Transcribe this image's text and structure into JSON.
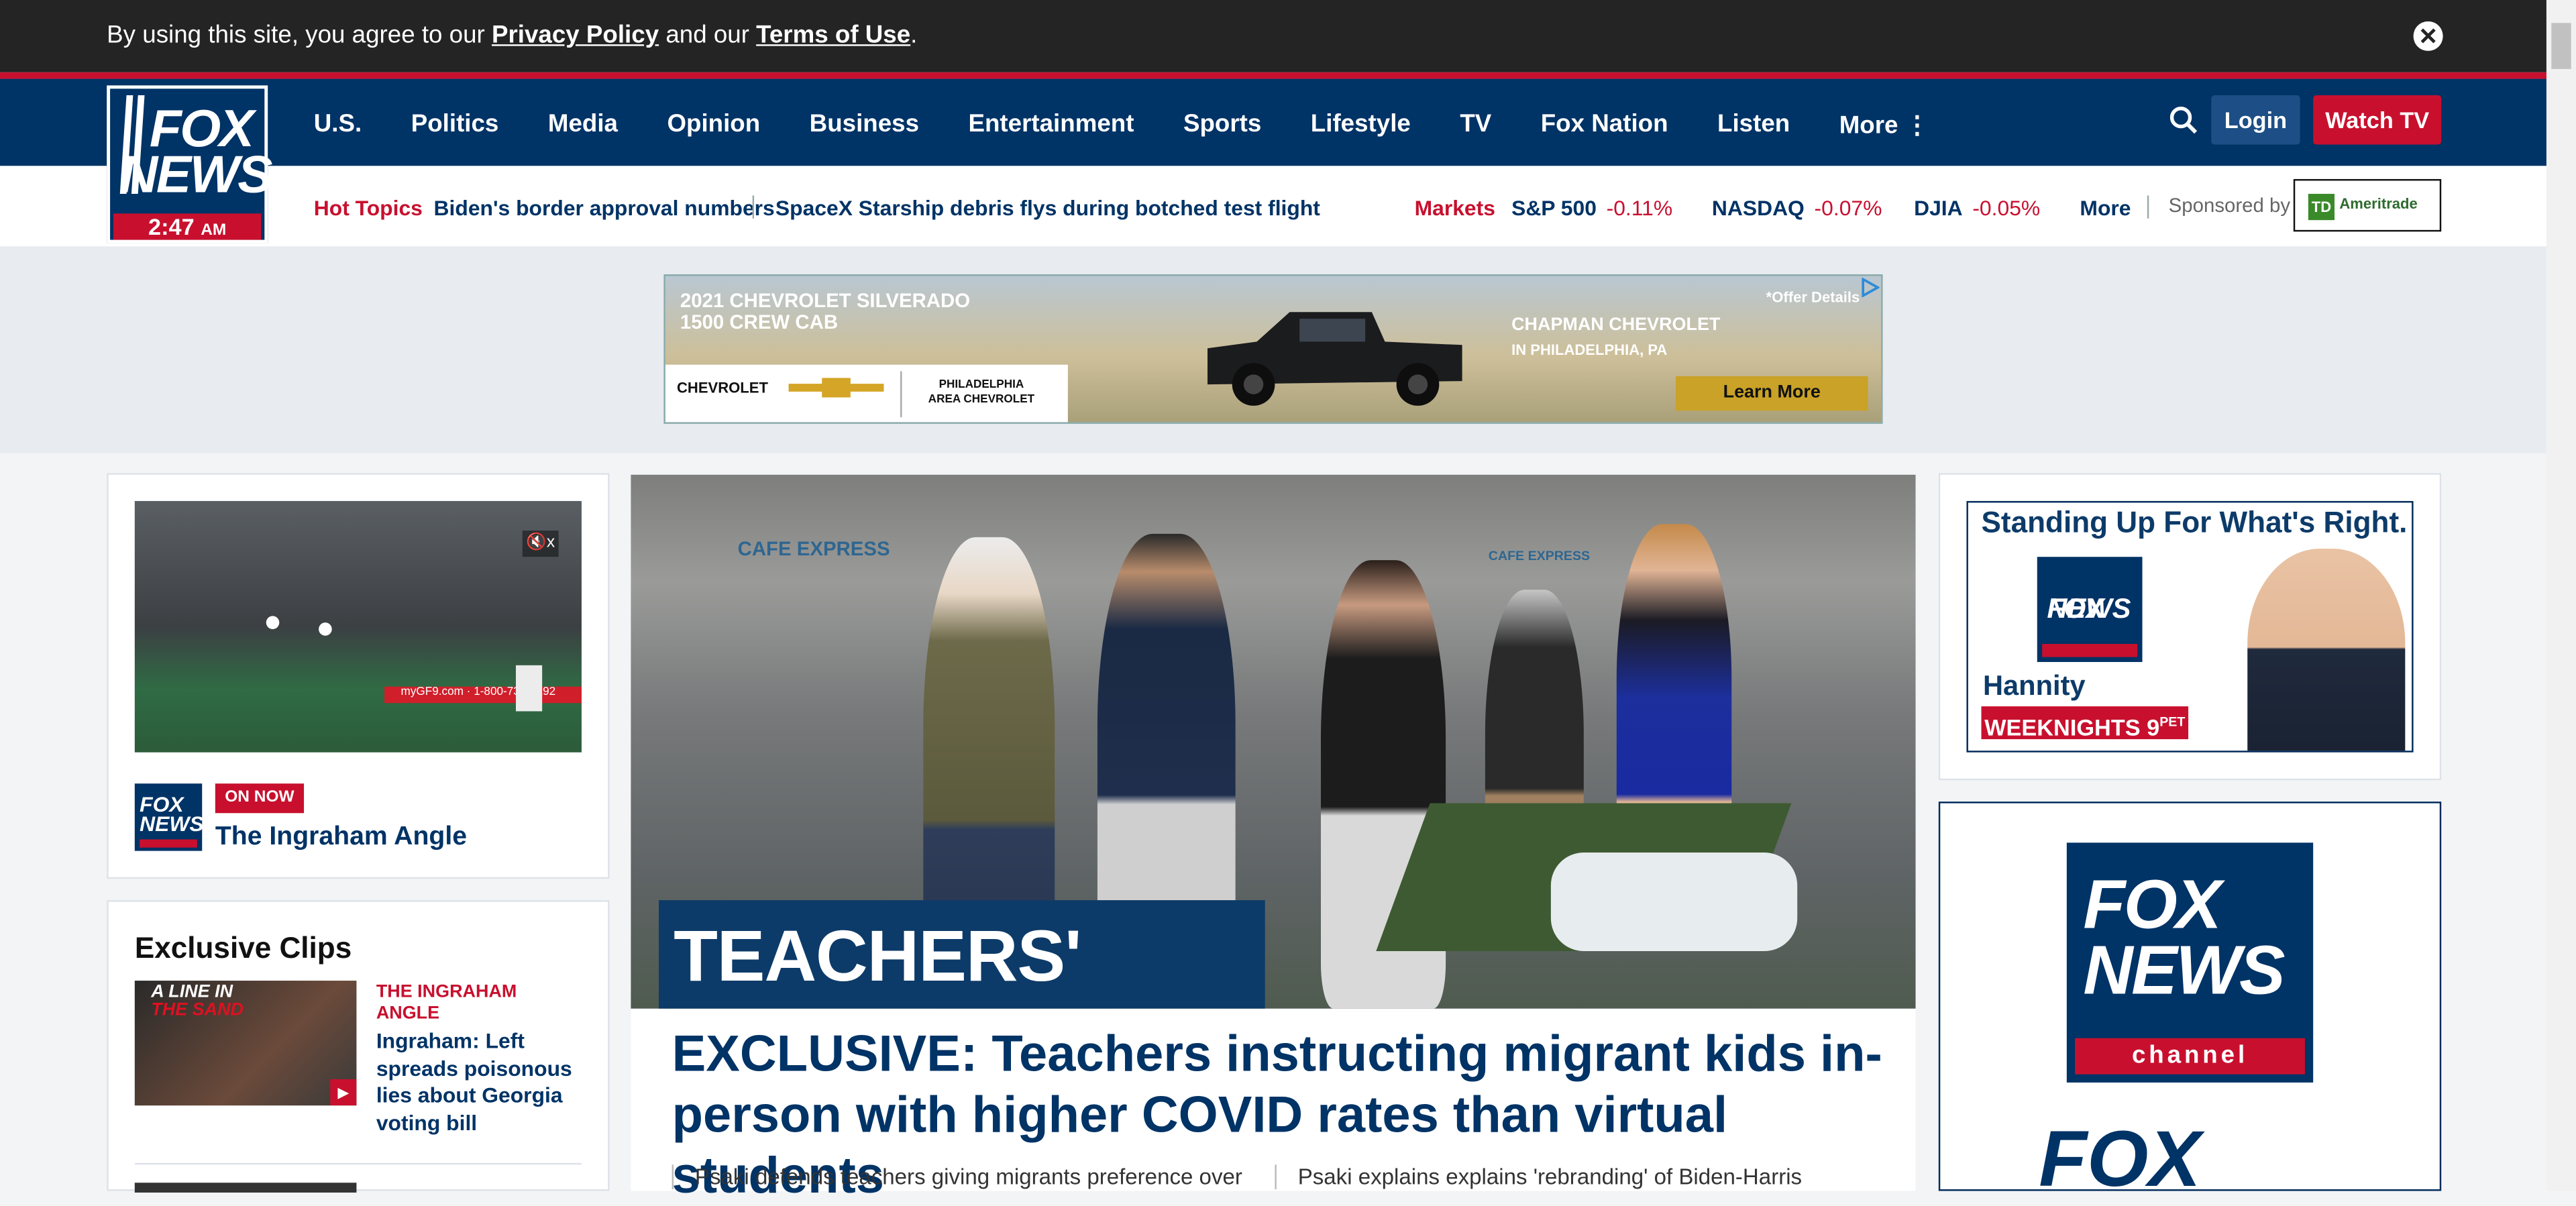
{
  "cookie": {
    "text_pre": "By using this site, you agree to our ",
    "privacy": "Privacy Policy",
    "text_mid": " and our ",
    "terms": "Terms of Use",
    "text_post": "."
  },
  "logo": {
    "word1": "FOX",
    "word2": "NEWS",
    "time": "2:47",
    "ampm": "AM"
  },
  "nav": {
    "items": [
      "U.S.",
      "Politics",
      "Media",
      "Opinion",
      "Business",
      "Entertainment",
      "Sports",
      "Lifestyle",
      "TV",
      "Fox Nation",
      "Listen",
      "More ⋮"
    ],
    "login": "Login",
    "watch": "Watch TV"
  },
  "hot": {
    "label": "Hot Topics",
    "topic1": "Biden's border approval numbers",
    "topic2": "SpaceX Starship debris flys during botched test flight",
    "markets": "Markets",
    "stocks": [
      {
        "name": "S&P 500",
        "change": "-0.11%"
      },
      {
        "name": "NASDAQ",
        "change": "-0.07%"
      },
      {
        "name": "DJIA",
        "change": "-0.05%"
      }
    ],
    "more": "More",
    "sponsored": "Sponsored by",
    "sponsor_name": "Ameritrade",
    "sponsor_box": "TD"
  },
  "ad": {
    "headline1": "2021 CHEVROLET SILVERADO",
    "headline2": "1500 CREW CAB",
    "dealer1": "CHAPMAN CHEVROLET",
    "dealer2": "IN PHILADELPHIA, PA",
    "offer": "*Offer Details",
    "cta": "Learn More",
    "brand": "CHEVROLET",
    "area1": "PHILADELPHIA",
    "area2": "AREA CHEVROLET"
  },
  "video": {
    "mute": "🔇x",
    "url": "myGF9.com",
    "phone": "1-800-737-5192",
    "on_now": "ON NOW",
    "show": "The Ingraham Angle"
  },
  "clips": {
    "heading": "Exclusive Clips",
    "thumb_line1": "A LINE IN",
    "thumb_line2": "THE SAND",
    "show": "THE INGRAHAM ANGLE",
    "title": "Ingraham: Left spreads poisonous lies about Georgia voting bill"
  },
  "hero": {
    "cafe": "CAFE EXPRESS",
    "tag": "TEACHERS' PETS",
    "title": "EXCLUSIVE: Teachers instructing migrant kids in-person with higher COVID rates than virtual students",
    "sub1": "Psaki defends teachers giving migrants preference over",
    "sub2": "Psaki explains explains 'rebranding' of Biden-Harris"
  },
  "right": {
    "hannity_top": "Standing Up For What's Right.",
    "hannity_name": "Hannity",
    "hannity_slot": "WEEKNIGHTS 9",
    "hannity_time": "PET",
    "channel": "channel",
    "bigfox_word": "FOX NEWS",
    "bigfox_partial": "FOX"
  }
}
